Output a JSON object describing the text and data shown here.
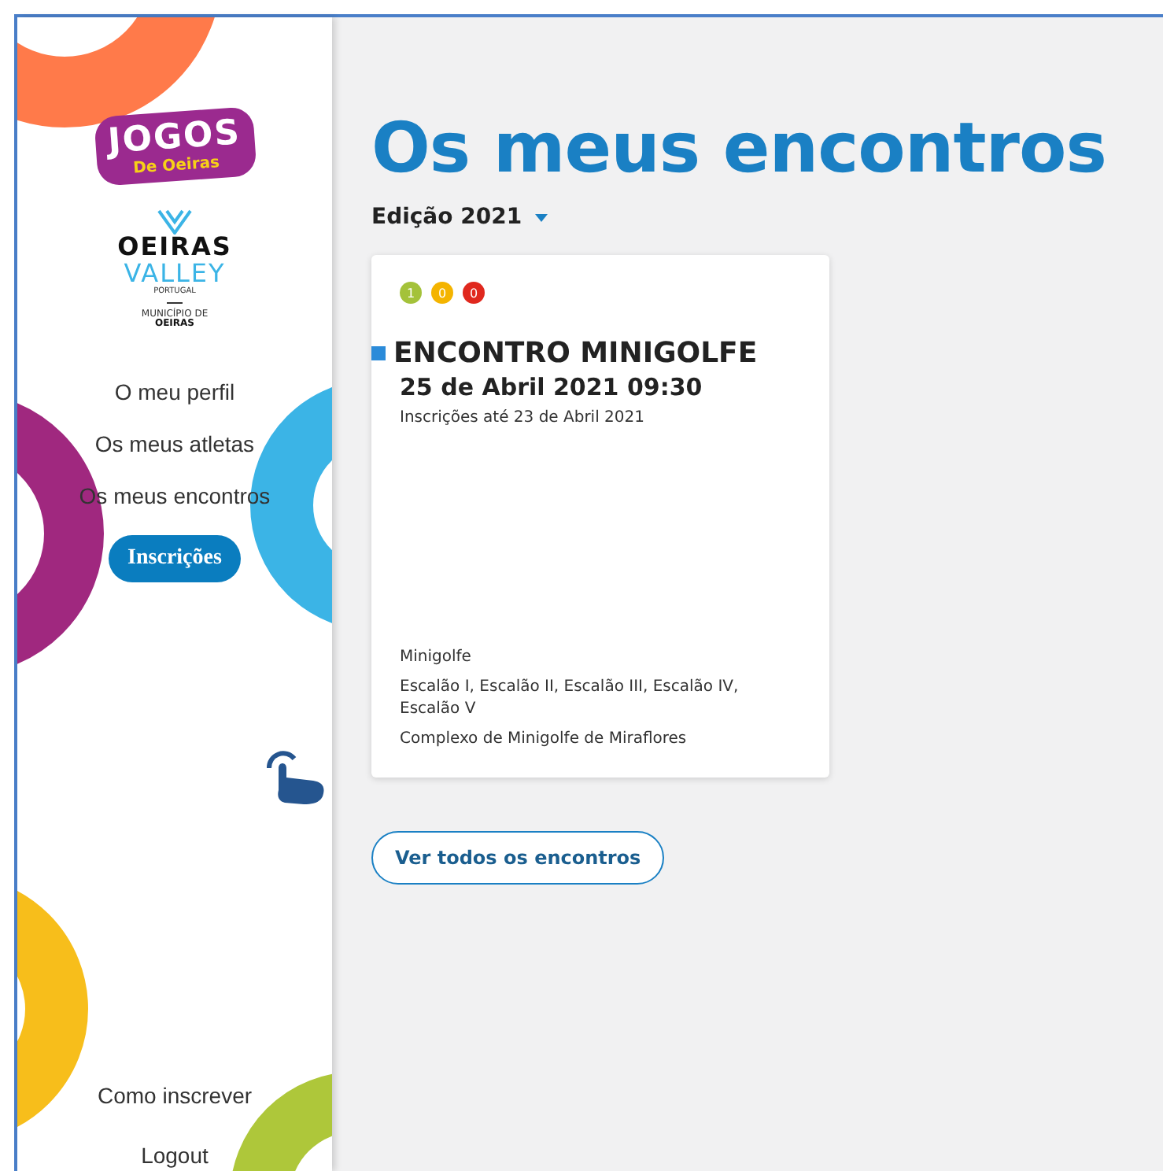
{
  "logos": {
    "games_title": "JOGOS",
    "games_subtitle": "De Oeiras",
    "valley_line1": "OEIRAS",
    "valley_line2": "VALLEY",
    "valley_line3": "PORTUGAL",
    "municipality_line1": "MUNICÍPIO DE",
    "municipality_line2": "OEIRAS"
  },
  "sidebar": {
    "items": [
      {
        "label": "O meu perfil",
        "selected": false
      },
      {
        "label": "Os meus atletas",
        "selected": false
      },
      {
        "label": "Os meus encontros",
        "selected": false
      },
      {
        "label": "Inscrições",
        "selected": true
      }
    ],
    "footer_items": [
      {
        "label": "Como inscrever"
      },
      {
        "label": "Logout"
      }
    ]
  },
  "page_title": "Os meus encontros",
  "edition_selector": {
    "value": "Edição 2021"
  },
  "events": [
    {
      "counters": [
        {
          "value": "1",
          "color": "#a4c23a"
        },
        {
          "value": "0",
          "color": "#f4b400"
        },
        {
          "value": "0",
          "color": "#e0281e"
        }
      ],
      "title": "ENCONTRO MINIGOLFE",
      "datetime": "25 de Abril 2021 09:30",
      "deadline": "Inscrições até 23 de Abril 2021",
      "sport": "Minigolfe",
      "levels": "Escalão I, Escalão II, Escalão III, Escalão IV, Escalão V",
      "venue": "Complexo de Minigolfe de Miraflores"
    }
  ],
  "view_all_button": "Ver todos os encontros"
}
